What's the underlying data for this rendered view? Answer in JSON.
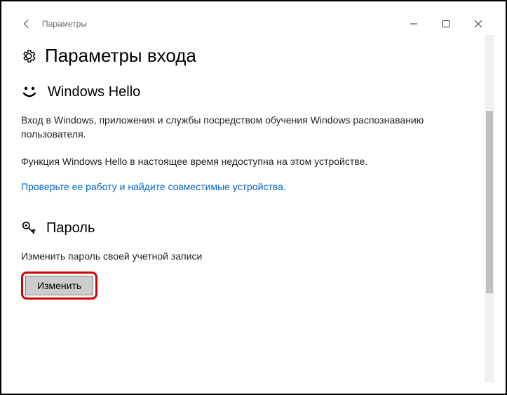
{
  "titlebar": {
    "back_aria": "Назад",
    "title": "Параметры",
    "minimize": "–",
    "maximize": "☐",
    "close": "✕"
  },
  "page": {
    "heading": "Параметры входа"
  },
  "hello": {
    "section_title": "Windows Hello",
    "desc": "Вход в Windows, приложения и службы посредством обучения Windows распознаванию пользователя.",
    "unavailable": "Функция Windows Hello в настоящее время недоступна на этом устройстве.",
    "link": "Проверьте ее работу и найдите совместимые устройства."
  },
  "password": {
    "section_title": "Пароль",
    "desc": "Изменить пароль своей учетной записи",
    "button": "Изменить"
  }
}
